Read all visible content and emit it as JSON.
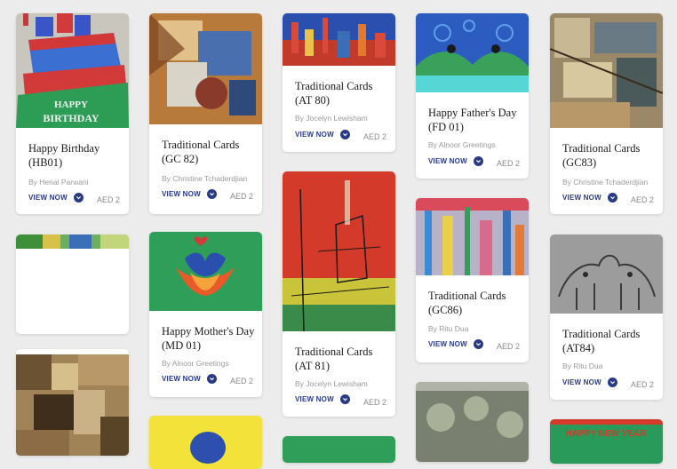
{
  "cards": [
    {
      "title": "Happy Birthday (HB01)",
      "author": "By Henal Parwani",
      "view_label": "VIEW NOW",
      "price": "AED 2"
    },
    {
      "title": "Traditional Cards (GC 82)",
      "author": "By Christine Tchaderdjian",
      "view_label": "VIEW NOW",
      "price": "AED 2"
    },
    {
      "title": "Traditional Cards (AT 80)",
      "author": "By Jocelyn Lewisham",
      "view_label": "VIEW NOW",
      "price": "AED 2"
    },
    {
      "title": "Happy Father's Day (FD 01)",
      "author": "By Alnoor Greetings",
      "view_label": "VIEW NOW",
      "price": "AED 2"
    },
    {
      "title": "Traditional Cards (GC83)",
      "author": "By Christine Tchaderdjian",
      "view_label": "VIEW NOW",
      "price": "AED 2"
    },
    {
      "title": "Happy Mother's Day (MD 01)",
      "author": "By Alnoor Greetings",
      "view_label": "VIEW NOW",
      "price": "AED 2"
    },
    {
      "title": "Traditional Cards (AT 81)",
      "author": "By Jocelyn Lewisham",
      "view_label": "VIEW NOW",
      "price": "AED 2"
    },
    {
      "title": "Traditional Cards (GC86)",
      "author": "By Ritu Dua",
      "view_label": "VIEW NOW",
      "price": "AED 2"
    },
    {
      "title": "Traditional Cards (AT84)",
      "author": "By Ritu Dua",
      "view_label": "VIEW NOW",
      "price": "AED 2"
    }
  ],
  "artwork_text": {
    "birthday_happy": "HAPPY",
    "birthday_word": "BIRTHDAY",
    "new_year": "HAPPY NEW YEAR"
  },
  "colors": {
    "accent": "#2a3b86",
    "page_bg": "#ececec"
  }
}
